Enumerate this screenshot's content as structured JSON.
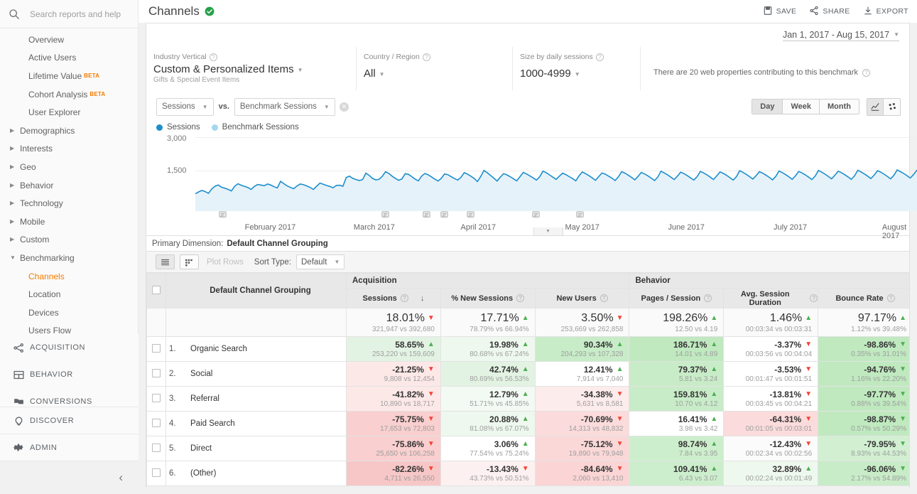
{
  "sidebar": {
    "search": {
      "placeholder": "Search reports and help"
    },
    "items": [
      {
        "label": "Overview",
        "arrow": "",
        "beta": ""
      },
      {
        "label": "Active Users",
        "arrow": "",
        "beta": ""
      },
      {
        "label": "Lifetime Value",
        "arrow": "",
        "beta": "BETA"
      },
      {
        "label": "Cohort Analysis",
        "arrow": "",
        "beta": "BETA"
      },
      {
        "label": "User Explorer",
        "arrow": "",
        "beta": ""
      },
      {
        "label": "Demographics",
        "arrow": "▶",
        "beta": ""
      },
      {
        "label": "Interests",
        "arrow": "▶",
        "beta": ""
      },
      {
        "label": "Geo",
        "arrow": "▶",
        "beta": ""
      },
      {
        "label": "Behavior",
        "arrow": "▶",
        "beta": ""
      },
      {
        "label": "Technology",
        "arrow": "▶",
        "beta": ""
      },
      {
        "label": "Mobile",
        "arrow": "▶",
        "beta": ""
      },
      {
        "label": "Custom",
        "arrow": "▶",
        "beta": ""
      },
      {
        "label": "Benchmarking",
        "arrow": "▼",
        "beta": ""
      },
      {
        "label": "Channels",
        "arrow": "",
        "beta": "",
        "active": true
      },
      {
        "label": "Location",
        "arrow": "",
        "beta": ""
      },
      {
        "label": "Devices",
        "arrow": "",
        "beta": ""
      },
      {
        "label": "Users Flow",
        "arrow": "",
        "beta": ""
      }
    ],
    "sections": [
      {
        "label": "ACQUISITION",
        "icon": "share-nodes-icon"
      },
      {
        "label": "BEHAVIOR",
        "icon": "layout-icon"
      },
      {
        "label": "CONVERSIONS",
        "icon": "flag-icon"
      },
      {
        "label": "DISCOVER",
        "icon": "lightbulb-icon"
      },
      {
        "label": "ADMIN",
        "icon": "gear-icon"
      }
    ],
    "collapse_icon": "‹",
    "active_color": "#f57c00"
  },
  "header": {
    "title": "Channels",
    "verified_icon": "verified-check-icon",
    "actions": [
      {
        "label": "SAVE",
        "icon": "save-icon"
      },
      {
        "label": "SHARE",
        "icon": "share-icon"
      },
      {
        "label": "EXPORT",
        "icon": "export-icon"
      }
    ],
    "date_range": "Jan 1, 2017 - Aug 15, 2017"
  },
  "filters": [
    {
      "label": "Industry Vertical",
      "value": "Custom & Personalized Items",
      "sub": "Gifts & Special Event Items",
      "help": "?"
    },
    {
      "label": "Country / Region",
      "value": "All",
      "sub": "",
      "help": "?"
    },
    {
      "label": "Size by daily sessions",
      "value": "1000-4999",
      "sub": "",
      "help": "?"
    }
  ],
  "benchmark_note": "There are 20 web properties contributing to this benchmark",
  "chart_controls": {
    "metric_primary": "Sessions",
    "vs_label": "vs.",
    "metric_secondary": "Benchmark Sessions",
    "granularity": [
      {
        "label": "Day",
        "selected": true
      },
      {
        "label": "Week",
        "selected": false
      },
      {
        "label": "Month",
        "selected": false
      }
    ],
    "chart_type_icons": [
      "line-chart-icon",
      "scatter-chart-icon"
    ]
  },
  "legend": [
    {
      "label": "Sessions",
      "color": "#1d8ecd"
    },
    {
      "label": "Benchmark Sessions",
      "color": "#a5d7f0"
    }
  ],
  "chart_data": {
    "type": "area",
    "title": "",
    "xlabel": "",
    "ylabel": "",
    "ylim": [
      0,
      3000
    ],
    "yticks": [
      1500,
      3000
    ],
    "ytick_labels": [
      "1,500",
      "3,000"
    ],
    "grid": true,
    "legend_position": "top-left",
    "xtick_labels": [
      "February 2017",
      "March 2017",
      "April 2017",
      "May 2017",
      "June 2017",
      "July 2017",
      "August 2017"
    ],
    "x_start": "Jan 1, 2017",
    "x_end": "Aug 15, 2017",
    "annotation_markers": 7,
    "series": [
      {
        "name": "Sessions",
        "color": "#1d8ecd",
        "values": [
          700,
          780,
          840,
          790,
          720,
          900,
          1010,
          1060,
          970,
          930,
          880,
          820,
          1010,
          1110,
          1050,
          1000,
          960,
          880,
          1000,
          1080,
          1060,
          1030,
          1100,
          1060,
          990,
          940,
          1210,
          1110,
          1020,
          960,
          910,
          1020,
          1100,
          1070,
          1020,
          960,
          880,
          1010,
          1140,
          1090,
          1040,
          1000,
          950,
          1040,
          1050,
          1010,
          1360,
          1420,
          1330,
          1280,
          1240,
          1280,
          1540,
          1450,
          1330,
          1270,
          1290,
          1410,
          1600,
          1530,
          1420,
          1330,
          1250,
          1310,
          1520,
          1490,
          1400,
          1300,
          1230,
          1420,
          1530,
          1470,
          1390,
          1300,
          1220,
          1330,
          1510,
          1480,
          1400,
          1320,
          1260,
          1370,
          1560,
          1500,
          1420,
          1330,
          1200,
          1400,
          1650,
          1560,
          1450,
          1340,
          1220,
          1380,
          1520,
          1470,
          1400,
          1310,
          1230,
          1400,
          1570,
          1510,
          1430,
          1350,
          1260,
          1390,
          1620,
          1560,
          1470,
          1380,
          1290,
          1420,
          1540,
          1480,
          1400,
          1320,
          1230,
          1430,
          1590,
          1520,
          1440,
          1350,
          1250,
          1400,
          1550,
          1500,
          1420,
          1340,
          1240,
          1390,
          1600,
          1540,
          1460,
          1370,
          1270,
          1410,
          1570,
          1510,
          1430,
          1340,
          1240,
          1380,
          1620,
          1550,
          1470,
          1380,
          1280,
          1420,
          1580,
          1520,
          1440,
          1350,
          1260,
          1400,
          1610,
          1550,
          1470,
          1380,
          1280,
          1430,
          1590,
          1530,
          1450,
          1360,
          1260,
          1400,
          1640,
          1570,
          1490,
          1400,
          1300,
          1440,
          1600,
          1540,
          1460,
          1370,
          1270,
          1410,
          1630,
          1560,
          1480,
          1390,
          1290,
          1430,
          1610,
          1550,
          1470,
          1380,
          1280,
          1420,
          1650,
          1580,
          1500,
          1410,
          1310,
          1450,
          1620,
          1560,
          1480,
          1390,
          1290,
          1430,
          1660,
          1590,
          1510,
          1420,
          1320,
          1460,
          1640,
          1580,
          1500,
          1410,
          1310,
          1450,
          1670,
          1600,
          1530,
          1440,
          1340,
          1480,
          1660,
          1620,
          1540
        ]
      }
    ]
  },
  "primary_dimension": {
    "label": "Primary Dimension:",
    "value": "Default Channel Grouping"
  },
  "table_toolbar": {
    "view_table_icon": "table-view-icon",
    "view_grid_icon": "grid-view-icon",
    "plot_rows": "Plot Rows",
    "sort_type_label": "Sort Type:",
    "sort_type_value": "Default"
  },
  "table": {
    "groups": [
      {
        "label": "Acquisition",
        "span": 3
      },
      {
        "label": "Behavior",
        "span": 3
      }
    ],
    "dimension_header": "Default Channel Grouping",
    "metrics": [
      {
        "label": "Sessions",
        "help": "?",
        "sorted": true,
        "sort_dir": "↓"
      },
      {
        "label": "% New Sessions",
        "help": "?",
        "sorted": false
      },
      {
        "label": "New Users",
        "help": "?",
        "sorted": false
      },
      {
        "label": "Pages / Session",
        "help": "?",
        "sorted": false
      },
      {
        "label": "Avg. Session Duration",
        "help": "?",
        "sorted": false
      },
      {
        "label": "Bounce Rate",
        "help": "?",
        "sorted": false
      }
    ],
    "totals": [
      {
        "pct": "18.01%",
        "dir": "down",
        "sub": "321,947 vs 392,680"
      },
      {
        "pct": "17.71%",
        "dir": "up",
        "sub": "78.79% vs 66.94%"
      },
      {
        "pct": "3.50%",
        "dir": "down",
        "sub": "253,669 vs 262,858"
      },
      {
        "pct": "198.26%",
        "dir": "up",
        "sub": "12.50 vs 4.19"
      },
      {
        "pct": "1.46%",
        "dir": "up",
        "sub": "00:03:34 vs 00:03:31"
      },
      {
        "pct": "97.17%",
        "dir": "up",
        "sub": "1.12% vs 39.48%"
      }
    ],
    "rows": [
      {
        "num": "1.",
        "name": "Organic Search",
        "cells": [
          {
            "pct": "58.65%",
            "dir": "up",
            "sub": "253,220 vs 159,609",
            "bg": "#e3f3e3"
          },
          {
            "pct": "19.98%",
            "dir": "up",
            "sub": "80.68% vs 67.24%",
            "bg": "#eef8ee"
          },
          {
            "pct": "90.34%",
            "dir": "up",
            "sub": "204,293 vs 107,328",
            "bg": "#c8ecc8"
          },
          {
            "pct": "186.71%",
            "dir": "up",
            "sub": "14.01 vs 4.89",
            "bg": "#c0e9c0"
          },
          {
            "pct": "-3.37%",
            "dir": "down",
            "sub": "00:03:56 vs 00:04:04",
            "bg": "#ffffff"
          },
          {
            "pct": "-98.86%",
            "dir": "updown",
            "sub": "0.35% vs 31.01%",
            "bg": "#c0e9c0"
          }
        ]
      },
      {
        "num": "2.",
        "name": "Social",
        "cells": [
          {
            "pct": "-21.25%",
            "dir": "down",
            "sub": "9,808 vs 12,454",
            "bg": "#fde8e8"
          },
          {
            "pct": "42.74%",
            "dir": "up",
            "sub": "80.69% vs 56.53%",
            "bg": "#e3f3e3"
          },
          {
            "pct": "12.41%",
            "dir": "up",
            "sub": "7,914 vs 7,040",
            "bg": "#ffffff"
          },
          {
            "pct": "79.37%",
            "dir": "up",
            "sub": "5.81 vs 3.24",
            "bg": "#c8ecc8"
          },
          {
            "pct": "-3.53%",
            "dir": "down",
            "sub": "00:01:47 vs 00:01:51",
            "bg": "#ffffff"
          },
          {
            "pct": "-94.76%",
            "dir": "updown",
            "sub": "1.16% vs 22.20%",
            "bg": "#c0e9c0"
          }
        ]
      },
      {
        "num": "3.",
        "name": "Referral",
        "cells": [
          {
            "pct": "-41.82%",
            "dir": "down",
            "sub": "10,890 vs 18,717",
            "bg": "#fde8e8"
          },
          {
            "pct": "12.79%",
            "dir": "up",
            "sub": "51.71% vs 45.85%",
            "bg": "#f3faf3"
          },
          {
            "pct": "-34.38%",
            "dir": "down",
            "sub": "5,631 vs 8,581",
            "bg": "#fdecec"
          },
          {
            "pct": "159.81%",
            "dir": "up",
            "sub": "10.70 vs 4.12",
            "bg": "#c8ecc8"
          },
          {
            "pct": "-13.81%",
            "dir": "down",
            "sub": "00:03:45 vs 00:04:21",
            "bg": "#ffffff"
          },
          {
            "pct": "-97.77%",
            "dir": "updown",
            "sub": "0.88% vs 39.54%",
            "bg": "#c0e9c0"
          }
        ]
      },
      {
        "num": "4.",
        "name": "Paid Search",
        "cells": [
          {
            "pct": "-75.75%",
            "dir": "down",
            "sub": "17,653 vs 72,803",
            "bg": "#f9cfcf"
          },
          {
            "pct": "20.88%",
            "dir": "up",
            "sub": "81.08% vs 67.07%",
            "bg": "#eef8ee"
          },
          {
            "pct": "-70.69%",
            "dir": "down",
            "sub": "14,313 vs 48,832",
            "bg": "#fbdbdb"
          },
          {
            "pct": "16.41%",
            "dir": "up",
            "sub": "3.98 vs 3.42",
            "bg": "#ffffff"
          },
          {
            "pct": "-64.31%",
            "dir": "down",
            "sub": "00:01:05 vs 00:03:01",
            "bg": "#fbdbdb"
          },
          {
            "pct": "-98.87%",
            "dir": "updown",
            "sub": "0.57% vs 50.29%",
            "bg": "#c0e9c0"
          }
        ]
      },
      {
        "num": "5.",
        "name": "Direct",
        "cells": [
          {
            "pct": "-75.86%",
            "dir": "down",
            "sub": "25,650 vs 106,258",
            "bg": "#f9cfcf"
          },
          {
            "pct": "3.06%",
            "dir": "up",
            "sub": "77.54% vs 75.24%",
            "bg": "#ffffff"
          },
          {
            "pct": "-75.12%",
            "dir": "down",
            "sub": "19,890 vs 79,948",
            "bg": "#fbd8d8"
          },
          {
            "pct": "98.74%",
            "dir": "up",
            "sub": "7.84 vs 3.95",
            "bg": "#cdeecd"
          },
          {
            "pct": "-12.43%",
            "dir": "down",
            "sub": "00:02:34 vs 00:02:56",
            "bg": "#fbfbfb"
          },
          {
            "pct": "-79.95%",
            "dir": "updown",
            "sub": "8.93% vs 44.53%",
            "bg": "#d2efd2"
          }
        ]
      },
      {
        "num": "6.",
        "name": "(Other)",
        "cells": [
          {
            "pct": "-82.26%",
            "dir": "down",
            "sub": "4,711 vs 26,550",
            "bg": "#f7c7c7"
          },
          {
            "pct": "-13.43%",
            "dir": "down",
            "sub": "43.73% vs 50.51%",
            "bg": "#fdf0f0"
          },
          {
            "pct": "-84.64%",
            "dir": "down",
            "sub": "2,060 vs 13,410",
            "bg": "#fbd5d5"
          },
          {
            "pct": "109.41%",
            "dir": "up",
            "sub": "6.43 vs 3.07",
            "bg": "#cdeecd"
          },
          {
            "pct": "32.89%",
            "dir": "up",
            "sub": "00:02:24 vs 00:01:49",
            "bg": "#eef8ee"
          },
          {
            "pct": "-96.06%",
            "dir": "updown",
            "sub": "2.17% vs 54.89%",
            "bg": "#c8ecc8"
          }
        ]
      }
    ]
  }
}
